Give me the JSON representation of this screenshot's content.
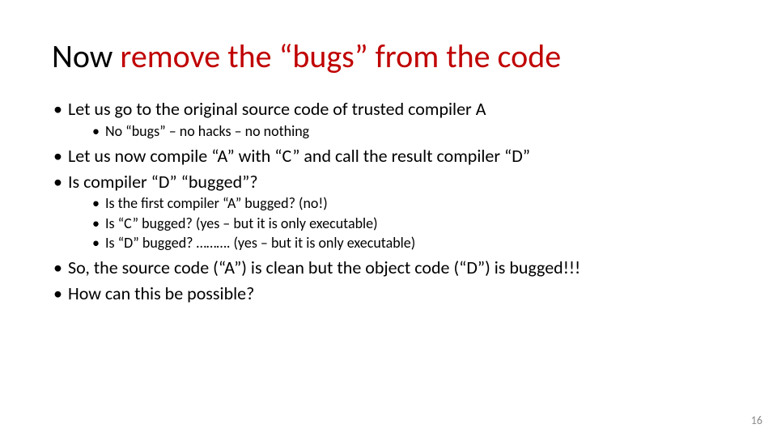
{
  "title": {
    "part1": "Now ",
    "part2": "remove the “bugs” from the code"
  },
  "bullets": [
    {
      "text": "Let us go to the original source code of trusted compiler A",
      "children": [
        "No “bugs” – no hacks – no nothing"
      ]
    },
    {
      "text": "Let us now compile “A” with “C” and call the result compiler “D”",
      "children": []
    },
    {
      "text": "Is compiler “D” “bugged”?",
      "children": [
        "Is the first compiler “A” bugged? (no!)",
        "Is “C” bugged? (yes – but it is only executable)",
        "Is “D” bugged? ………. (yes – but it is only executable)"
      ]
    },
    {
      "text": "So, the source code (“A”) is clean but the object code (“D”) is bugged!!!",
      "children": []
    },
    {
      "text": "How can this be possible?",
      "children": []
    }
  ],
  "page_number": "16"
}
